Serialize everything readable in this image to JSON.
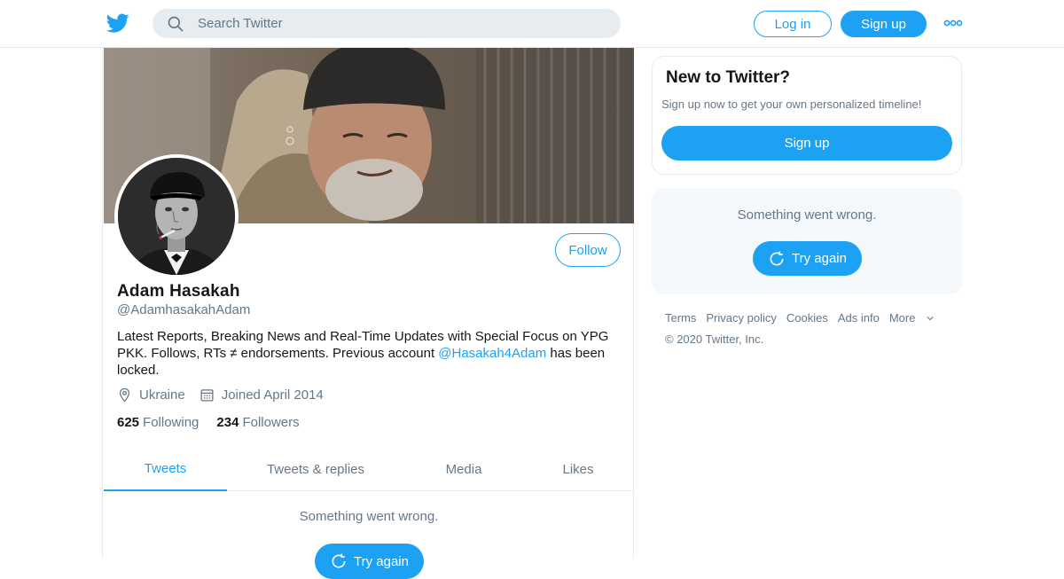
{
  "header": {
    "search_placeholder": "Search Twitter",
    "login_label": "Log in",
    "signup_label": "Sign up"
  },
  "profile": {
    "name": "Adam Hasakah",
    "handle": "@AdamhasakahAdam",
    "bio_text": "Latest Reports, Breaking News and Real-Time Updates with Special Focus on YPG PKK. Follows, RTs ≠ endorsements. Previous account ",
    "bio_link": "@Hasakah4Adam",
    "bio_end": " has been locked.",
    "location": "Ukraine",
    "joined": "Joined April 2014",
    "following_count": "625",
    "following_label": "Following",
    "followers_count": "234",
    "followers_label": "Followers",
    "follow_label": "Follow"
  },
  "tabs": [
    {
      "label": "Tweets",
      "active": true
    },
    {
      "label": "Tweets & replies",
      "active": false
    },
    {
      "label": "Media",
      "active": false
    },
    {
      "label": "Likes",
      "active": false
    }
  ],
  "timeline": {
    "error_text": "Something went wrong.",
    "retry_label": "Try again"
  },
  "sidebar": {
    "new_title": "New to Twitter?",
    "new_subtitle": "Sign up now to get your own personalized timeline!",
    "signup_label": "Sign up",
    "error_text": "Something went wrong.",
    "retry_label": "Try again"
  },
  "footer": {
    "links": [
      "Terms",
      "Privacy policy",
      "Cookies",
      "Ads info",
      "More"
    ],
    "copyright": "© 2020 Twitter, Inc."
  },
  "colors": {
    "accent": "#1da1f2",
    "secondary_text": "#657786",
    "border": "#e6ecf0"
  }
}
